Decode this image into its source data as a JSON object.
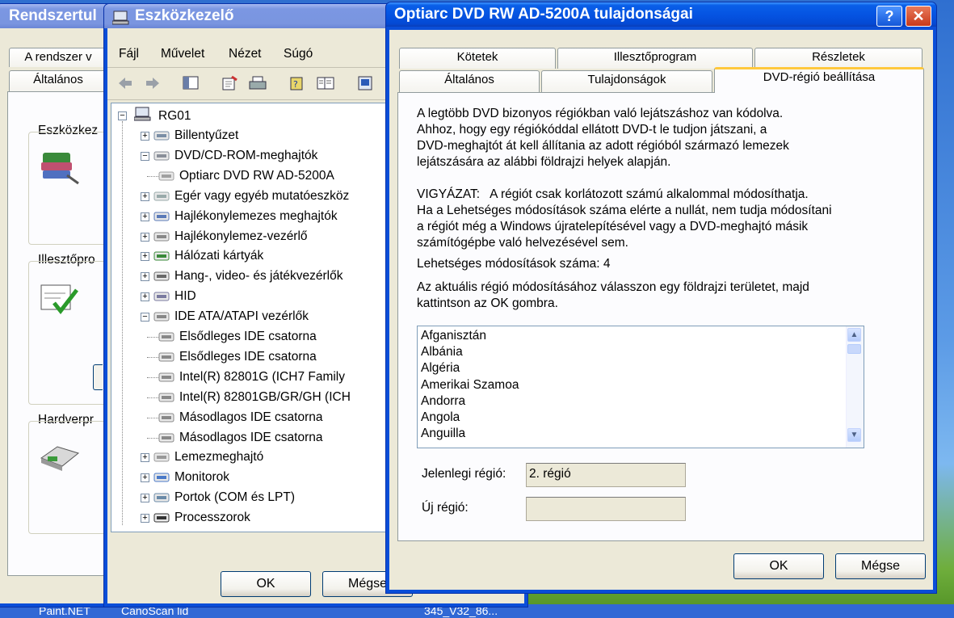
{
  "taskbar": {
    "items": [
      "Paint.NET",
      "CanoScan lid",
      "345_V32_86..."
    ]
  },
  "sysprops": {
    "title": "Rendszertul",
    "tabs": [
      "A rendszer v",
      "Általános"
    ],
    "groups": [
      "Eszközkez",
      "Illesztőpro",
      "Hardverpr"
    ]
  },
  "devmgr": {
    "title": "Eszközkezelő",
    "menu": [
      "Fájl",
      "Művelet",
      "Nézet",
      "Súgó"
    ],
    "root": "RG01",
    "tree": [
      {
        "label": "Billentyűzet",
        "level": 1,
        "expand": "+"
      },
      {
        "label": "DVD/CD-ROM-meghajtók",
        "level": 1,
        "expand": "-"
      },
      {
        "label": "Optiarc DVD RW AD-5200A",
        "level": 2,
        "expand": ""
      },
      {
        "label": "Egér vagy egyéb mutatóeszköz",
        "level": 1,
        "expand": "+"
      },
      {
        "label": "Hajlékonylemezes meghajtók",
        "level": 1,
        "expand": "+"
      },
      {
        "label": "Hajlékonylemez-vezérlő",
        "level": 1,
        "expand": "+"
      },
      {
        "label": "Hálózati kártyák",
        "level": 1,
        "expand": "+"
      },
      {
        "label": "Hang-, video- és játékvezérlők",
        "level": 1,
        "expand": "+"
      },
      {
        "label": "HID",
        "level": 1,
        "expand": "+"
      },
      {
        "label": "IDE ATA/ATAPI vezérlők",
        "level": 1,
        "expand": "-"
      },
      {
        "label": "Elsődleges IDE csatorna",
        "level": 2,
        "expand": ""
      },
      {
        "label": "Elsődleges IDE csatorna",
        "level": 2,
        "expand": ""
      },
      {
        "label": "Intel(R) 82801G (ICH7 Family",
        "level": 2,
        "expand": ""
      },
      {
        "label": "Intel(R) 82801GB/GR/GH (ICH",
        "level": 2,
        "expand": ""
      },
      {
        "label": "Másodlagos IDE csatorna",
        "level": 2,
        "expand": ""
      },
      {
        "label": "Másodlagos IDE csatorna",
        "level": 2,
        "expand": ""
      },
      {
        "label": "Lemezmeghajtó",
        "level": 1,
        "expand": "+"
      },
      {
        "label": "Monitorok",
        "level": 1,
        "expand": "+"
      },
      {
        "label": "Portok (COM és LPT)",
        "level": 1,
        "expand": "+"
      },
      {
        "label": "Processzorok",
        "level": 1,
        "expand": "+"
      }
    ],
    "ok_label": "OK",
    "cancel_label": "Mégse"
  },
  "props": {
    "title": "Optiarc DVD RW AD-5200A tulajdonságai",
    "tabs_row1": [
      "Kötetek",
      "Illesztőprogram",
      "Részletek"
    ],
    "tabs_row2": [
      "Általános",
      "Tulajdonságok",
      "DVD-régió beállítása"
    ],
    "intro": [
      "A legtöbb DVD bizonyos régiókban való lejátszáshoz van kódolva.",
      "Ahhoz, hogy egy régiókóddal ellátott DVD-t le tudjon játszani, a",
      "DVD-meghajtót át kell állítania az adott régióból származó lemezek",
      "lejátszására az alábbi földrajzi helyek alapján."
    ],
    "warning": [
      "VIGYÁZAT:   A régiót csak korlátozott számú alkalommal módosíthatja.",
      "Ha a Lehetséges módosítások száma elérte a nullát, nem tudja módosítani",
      "a régiót még a Windows újratelepítésével vagy a DVD-meghajtó másik",
      "számítógépbe való helvezésével sem."
    ],
    "changes_left": "Lehetséges módosítások száma: 4",
    "instruction": [
      "Az aktuális régió módosításához válasszon egy földrajzi területet, majd",
      "kattintson az OK gombra."
    ],
    "regions": [
      "Afganisztán",
      "Albánia",
      "Algéria",
      "Amerikai Szamoa",
      "Andorra",
      "Angola",
      "Anguilla"
    ],
    "current_region_label": "Jelenlegi régió:",
    "current_region_value": "2. régió",
    "new_region_label": "Új régió:",
    "new_region_value": "",
    "ok_label": "OK",
    "cancel_label": "Mégse",
    "help_glyph": "?",
    "close_glyph": "✕"
  }
}
